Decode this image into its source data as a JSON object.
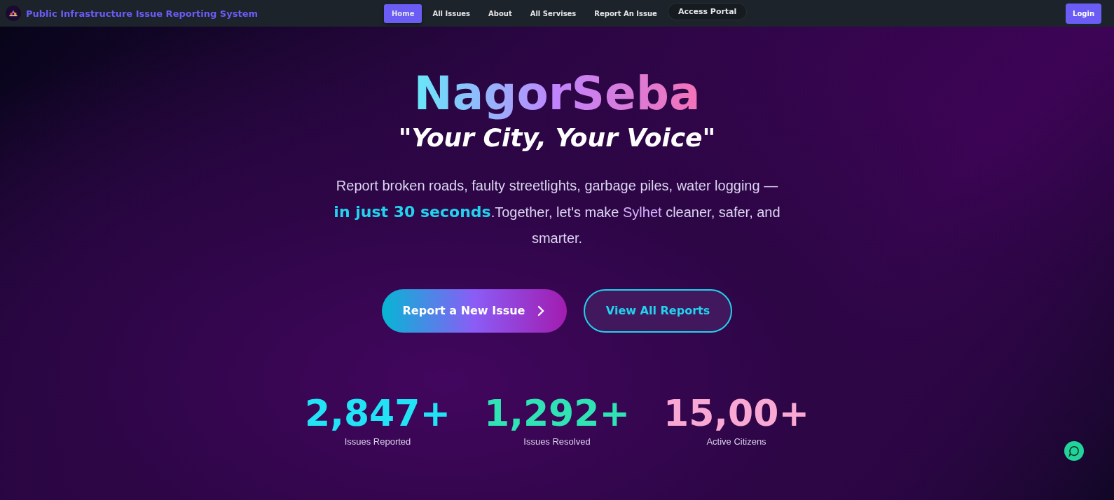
{
  "navbar": {
    "brand": "Public Infrastructure Issue Reporting System",
    "links": [
      {
        "label": "Home",
        "selected": true
      },
      {
        "label": "All Issues",
        "selected": false
      },
      {
        "label": "About",
        "selected": false
      },
      {
        "label": "All Servises",
        "selected": false
      },
      {
        "label": "Report An Issue",
        "selected": false
      }
    ],
    "portal": "Access Portal",
    "login": "Login"
  },
  "hero": {
    "title": "NagorSeba",
    "tagline": "\"Your City, Your Voice\"",
    "description": [
      {
        "text": "Report broken roads, faulty streetlights, garbage piles, water logging — ",
        "kind": "plain"
      },
      {
        "text": "in just 30 seconds",
        "kind": "highlight"
      },
      {
        "text": ".Together, let's make ",
        "kind": "plain"
      },
      {
        "text": "Sylhet",
        "kind": "place"
      },
      {
        "text": " cleaner, safer, and smarter.",
        "kind": "plain"
      }
    ],
    "primary_button": "Report a New Issue",
    "secondary_button": "View All Reports"
  },
  "stats": [
    {
      "value": "2,847+",
      "label": "Issues Reported",
      "color": "#22e3f5"
    },
    {
      "value": "1,292+",
      "label": "Issues Resolved",
      "color": "#2fe3b4"
    },
    {
      "value": "15,00+",
      "label": "Active Citizens",
      "color": "#f9a8d4"
    }
  ]
}
